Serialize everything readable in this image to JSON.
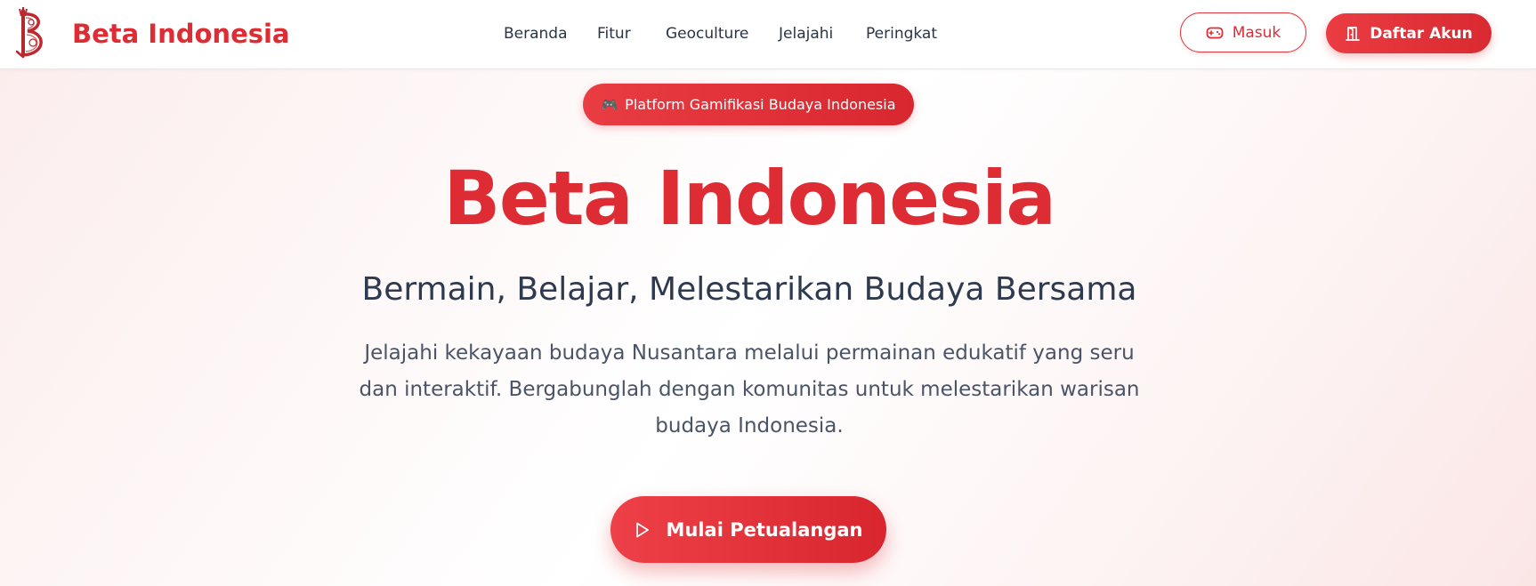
{
  "brand": {
    "name": "Beta Indonesia",
    "color": "#de2c34",
    "logo_icon": "batik-b-logo"
  },
  "nav": {
    "items": [
      {
        "label": "Beranda"
      },
      {
        "label": "Fitur"
      },
      {
        "label": "Geoculture"
      },
      {
        "label": "Jelajahi"
      },
      {
        "label": "Peringkat"
      }
    ]
  },
  "auth": {
    "login_label": "Masuk",
    "login_icon": "gamepad-icon",
    "register_label": "Daftar Akun",
    "register_icon": "door-icon"
  },
  "hero": {
    "badge_icon": "🎮",
    "badge_label": "Platform Gamifikasi Budaya Indonesia",
    "title": "Beta Indonesia",
    "subtitle": "Bermain, Belajar, Melestarikan Budaya Bersama",
    "description": "Jelajahi kekayaan budaya Nusantara melalui permainan edukatif yang seru dan interaktif. Bergabunglah dengan komunitas untuk melestarikan warisan budaya Indonesia.",
    "cta_label": "Mulai Petualangan",
    "cta_icon": "play-icon"
  },
  "colors": {
    "accent": "#de2c34",
    "text_dark": "#2d3a4f",
    "text_muted": "#4a5467"
  }
}
